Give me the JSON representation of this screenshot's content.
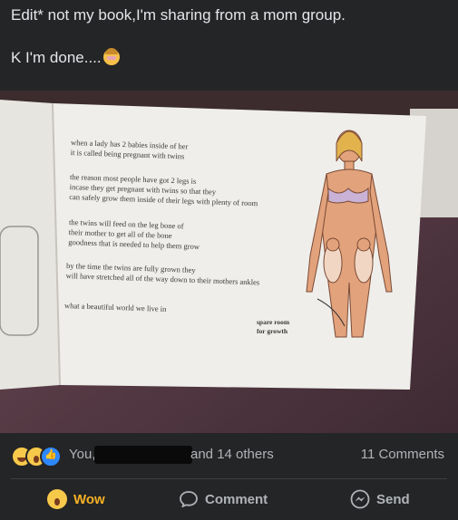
{
  "post": {
    "line1": "Edit* not my book,I'm sharing from a mom group.",
    "line2": "K I'm done....",
    "line2_emoji": "person-facepalming-emoji"
  },
  "photo": {
    "book_paragraphs": [
      "when a lady has 2 babies inside of her it is called being pregnant with twins",
      "the reason most people have got 2 legs is incase they get pregnant with twins so that they can safely grow them inside of their legs with plenty of room",
      "the twins will feed on the leg bone of their mother to get all of the bone goodness that is needed to help them grow",
      "by the time the twins are fully grown they will have stretched all of the way down to their mothers ankles",
      "what a beautiful world we live in"
    ],
    "annotation": [
      "spare room",
      "for growth"
    ]
  },
  "reactions": {
    "icons": [
      "haha-icon",
      "wow-icon",
      "like-icon"
    ],
    "text_start": "You,",
    "text_end": "and 14 others",
    "comments": "11 Comments"
  },
  "actions": {
    "wow": "Wow",
    "comment": "Comment",
    "send": "Send"
  },
  "colors": {
    "background": "#242526",
    "text": "#e4e6eb",
    "muted": "#b0b3b8",
    "wow_accent": "#f7b125",
    "like_blue": "#2d88ff"
  }
}
